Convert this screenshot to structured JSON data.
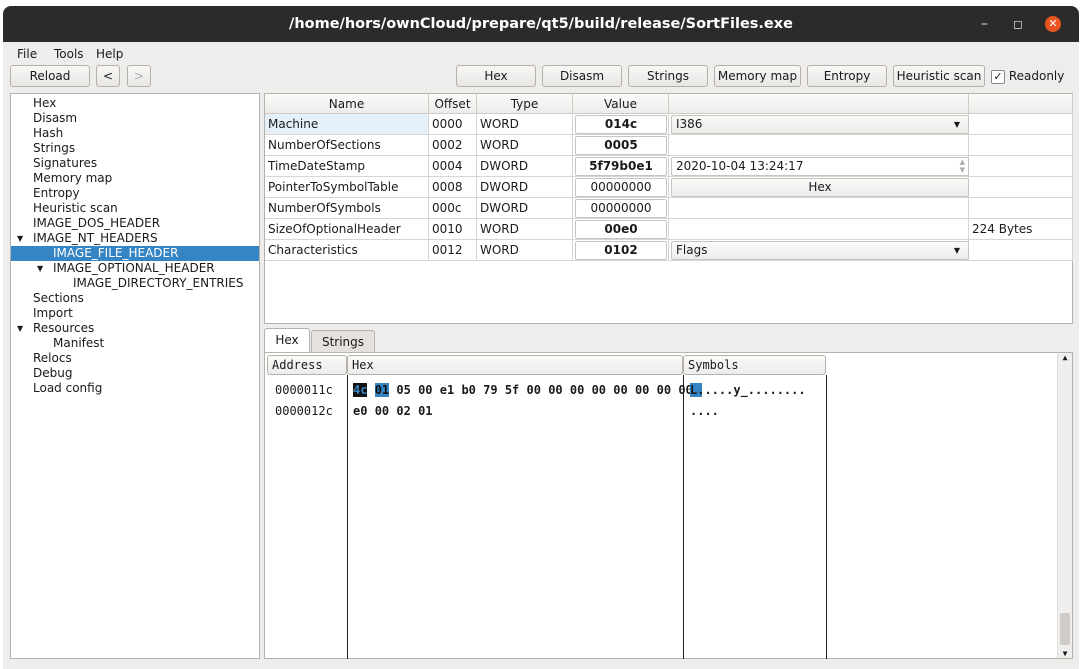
{
  "window": {
    "title": "/home/hors/ownCloud/prepare/qt5/build/release/SortFiles.exe"
  },
  "menu": [
    "File",
    "Tools",
    "Help"
  ],
  "toolbar": {
    "reload": "Reload",
    "back": "<",
    "forward": ">",
    "hex": "Hex",
    "disasm": "Disasm",
    "strings": "Strings",
    "memory_map": "Memory map",
    "entropy": "Entropy",
    "heuristic": "Heuristic scan",
    "readonly": "Readonly",
    "readonly_checked": true
  },
  "tree": [
    {
      "label": "Hex",
      "level": 0
    },
    {
      "label": "Disasm",
      "level": 0
    },
    {
      "label": "Hash",
      "level": 0
    },
    {
      "label": "Strings",
      "level": 0
    },
    {
      "label": "Signatures",
      "level": 0
    },
    {
      "label": "Memory map",
      "level": 0
    },
    {
      "label": "Entropy",
      "level": 0
    },
    {
      "label": "Heuristic scan",
      "level": 0
    },
    {
      "label": "IMAGE_DOS_HEADER",
      "level": 0
    },
    {
      "label": "IMAGE_NT_HEADERS",
      "level": 0,
      "expanded": true
    },
    {
      "label": "IMAGE_FILE_HEADER",
      "level": 1,
      "selected": true
    },
    {
      "label": "IMAGE_OPTIONAL_HEADER",
      "level": 1,
      "expanded": true
    },
    {
      "label": "IMAGE_DIRECTORY_ENTRIES",
      "level": 2
    },
    {
      "label": "Sections",
      "level": 0
    },
    {
      "label": "Import",
      "level": 0
    },
    {
      "label": "Resources",
      "level": 0,
      "expanded": true
    },
    {
      "label": "Manifest",
      "level": 1
    },
    {
      "label": "Relocs",
      "level": 0
    },
    {
      "label": "Debug",
      "level": 0
    },
    {
      "label": "Load config",
      "level": 0
    }
  ],
  "table": {
    "headers": [
      "Name",
      "Offset",
      "Type",
      "Value",
      "",
      ""
    ],
    "rows": [
      {
        "name": "Machine",
        "offset": "0000",
        "type": "WORD",
        "value": "014c",
        "bold": true,
        "extra": {
          "kind": "combo",
          "text": "I386"
        },
        "info": ""
      },
      {
        "name": "NumberOfSections",
        "offset": "0002",
        "type": "WORD",
        "value": "0005",
        "bold": true,
        "extra": null,
        "info": ""
      },
      {
        "name": "TimeDateStamp",
        "offset": "0004",
        "type": "DWORD",
        "value": "5f79b0e1",
        "bold": true,
        "extra": {
          "kind": "datetime",
          "text": "2020-10-04 13:24:17"
        },
        "info": ""
      },
      {
        "name": "PointerToSymbolTable",
        "offset": "0008",
        "type": "DWORD",
        "value": "00000000",
        "bold": false,
        "extra": {
          "kind": "button",
          "text": "Hex"
        },
        "info": ""
      },
      {
        "name": "NumberOfSymbols",
        "offset": "000c",
        "type": "DWORD",
        "value": "00000000",
        "bold": false,
        "extra": null,
        "info": ""
      },
      {
        "name": "SizeOfOptionalHeader",
        "offset": "0010",
        "type": "WORD",
        "value": "00e0",
        "bold": true,
        "extra": null,
        "info": "224 Bytes"
      },
      {
        "name": "Characteristics",
        "offset": "0012",
        "type": "WORD",
        "value": "0102",
        "bold": true,
        "extra": {
          "kind": "combo",
          "text": "Flags"
        },
        "info": ""
      }
    ]
  },
  "tabs": [
    "Hex",
    "Strings"
  ],
  "hexview": {
    "headers": [
      "Address",
      "Hex",
      "Symbols"
    ],
    "rows": [
      {
        "address": "0000011c",
        "bytes": [
          "4c",
          "01",
          "05",
          "00",
          "e1",
          "b0",
          "79",
          "5f",
          "00",
          "00",
          "00",
          "00",
          "00",
          "00",
          "00",
          "00"
        ],
        "symbols": "L.....y_........"
      },
      {
        "address": "0000012c",
        "bytes": [
          "e0",
          "00",
          "02",
          "01"
        ],
        "symbols": "...."
      }
    ]
  },
  "colors": {
    "selection": "#3584c4",
    "titlebar": "#2d2b2a",
    "close": "#e95420"
  }
}
